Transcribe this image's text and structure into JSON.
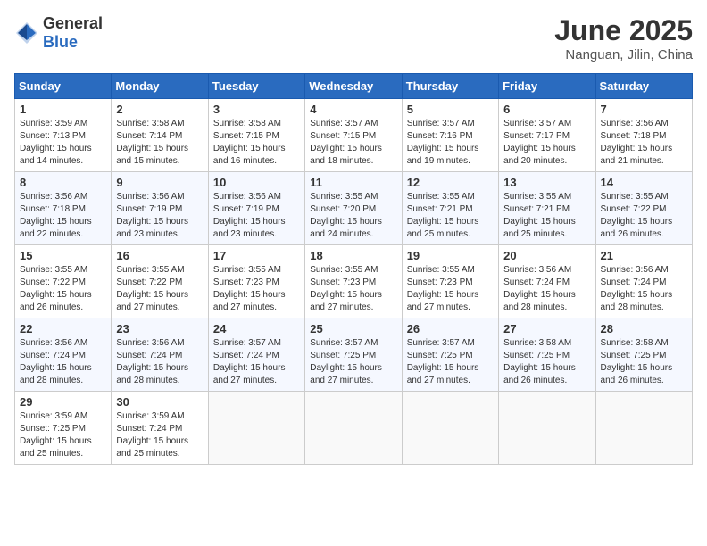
{
  "logo": {
    "general": "General",
    "blue": "Blue"
  },
  "header": {
    "title": "June 2025",
    "subtitle": "Nanguan, Jilin, China"
  },
  "weekdays": [
    "Sunday",
    "Monday",
    "Tuesday",
    "Wednesday",
    "Thursday",
    "Friday",
    "Saturday"
  ],
  "rows": [
    [
      {
        "day": "1",
        "sunrise": "3:59 AM",
        "sunset": "7:13 PM",
        "daylight": "15 hours and 14 minutes."
      },
      {
        "day": "2",
        "sunrise": "3:58 AM",
        "sunset": "7:14 PM",
        "daylight": "15 hours and 15 minutes."
      },
      {
        "day": "3",
        "sunrise": "3:58 AM",
        "sunset": "7:15 PM",
        "daylight": "15 hours and 16 minutes."
      },
      {
        "day": "4",
        "sunrise": "3:57 AM",
        "sunset": "7:15 PM",
        "daylight": "15 hours and 18 minutes."
      },
      {
        "day": "5",
        "sunrise": "3:57 AM",
        "sunset": "7:16 PM",
        "daylight": "15 hours and 19 minutes."
      },
      {
        "day": "6",
        "sunrise": "3:57 AM",
        "sunset": "7:17 PM",
        "daylight": "15 hours and 20 minutes."
      },
      {
        "day": "7",
        "sunrise": "3:56 AM",
        "sunset": "7:18 PM",
        "daylight": "15 hours and 21 minutes."
      }
    ],
    [
      {
        "day": "8",
        "sunrise": "3:56 AM",
        "sunset": "7:18 PM",
        "daylight": "15 hours and 22 minutes."
      },
      {
        "day": "9",
        "sunrise": "3:56 AM",
        "sunset": "7:19 PM",
        "daylight": "15 hours and 23 minutes."
      },
      {
        "day": "10",
        "sunrise": "3:56 AM",
        "sunset": "7:19 PM",
        "daylight": "15 hours and 23 minutes."
      },
      {
        "day": "11",
        "sunrise": "3:55 AM",
        "sunset": "7:20 PM",
        "daylight": "15 hours and 24 minutes."
      },
      {
        "day": "12",
        "sunrise": "3:55 AM",
        "sunset": "7:21 PM",
        "daylight": "15 hours and 25 minutes."
      },
      {
        "day": "13",
        "sunrise": "3:55 AM",
        "sunset": "7:21 PM",
        "daylight": "15 hours and 25 minutes."
      },
      {
        "day": "14",
        "sunrise": "3:55 AM",
        "sunset": "7:22 PM",
        "daylight": "15 hours and 26 minutes."
      }
    ],
    [
      {
        "day": "15",
        "sunrise": "3:55 AM",
        "sunset": "7:22 PM",
        "daylight": "15 hours and 26 minutes."
      },
      {
        "day": "16",
        "sunrise": "3:55 AM",
        "sunset": "7:22 PM",
        "daylight": "15 hours and 27 minutes."
      },
      {
        "day": "17",
        "sunrise": "3:55 AM",
        "sunset": "7:23 PM",
        "daylight": "15 hours and 27 minutes."
      },
      {
        "day": "18",
        "sunrise": "3:55 AM",
        "sunset": "7:23 PM",
        "daylight": "15 hours and 27 minutes."
      },
      {
        "day": "19",
        "sunrise": "3:55 AM",
        "sunset": "7:23 PM",
        "daylight": "15 hours and 27 minutes."
      },
      {
        "day": "20",
        "sunrise": "3:56 AM",
        "sunset": "7:24 PM",
        "daylight": "15 hours and 28 minutes."
      },
      {
        "day": "21",
        "sunrise": "3:56 AM",
        "sunset": "7:24 PM",
        "daylight": "15 hours and 28 minutes."
      }
    ],
    [
      {
        "day": "22",
        "sunrise": "3:56 AM",
        "sunset": "7:24 PM",
        "daylight": "15 hours and 28 minutes."
      },
      {
        "day": "23",
        "sunrise": "3:56 AM",
        "sunset": "7:24 PM",
        "daylight": "15 hours and 28 minutes."
      },
      {
        "day": "24",
        "sunrise": "3:57 AM",
        "sunset": "7:24 PM",
        "daylight": "15 hours and 27 minutes."
      },
      {
        "day": "25",
        "sunrise": "3:57 AM",
        "sunset": "7:25 PM",
        "daylight": "15 hours and 27 minutes."
      },
      {
        "day": "26",
        "sunrise": "3:57 AM",
        "sunset": "7:25 PM",
        "daylight": "15 hours and 27 minutes."
      },
      {
        "day": "27",
        "sunrise": "3:58 AM",
        "sunset": "7:25 PM",
        "daylight": "15 hours and 26 minutes."
      },
      {
        "day": "28",
        "sunrise": "3:58 AM",
        "sunset": "7:25 PM",
        "daylight": "15 hours and 26 minutes."
      }
    ],
    [
      {
        "day": "29",
        "sunrise": "3:59 AM",
        "sunset": "7:25 PM",
        "daylight": "15 hours and 25 minutes."
      },
      {
        "day": "30",
        "sunrise": "3:59 AM",
        "sunset": "7:24 PM",
        "daylight": "15 hours and 25 minutes."
      },
      null,
      null,
      null,
      null,
      null
    ]
  ],
  "labels": {
    "sunrise": "Sunrise:",
    "sunset": "Sunset:",
    "daylight": "Daylight hours"
  }
}
